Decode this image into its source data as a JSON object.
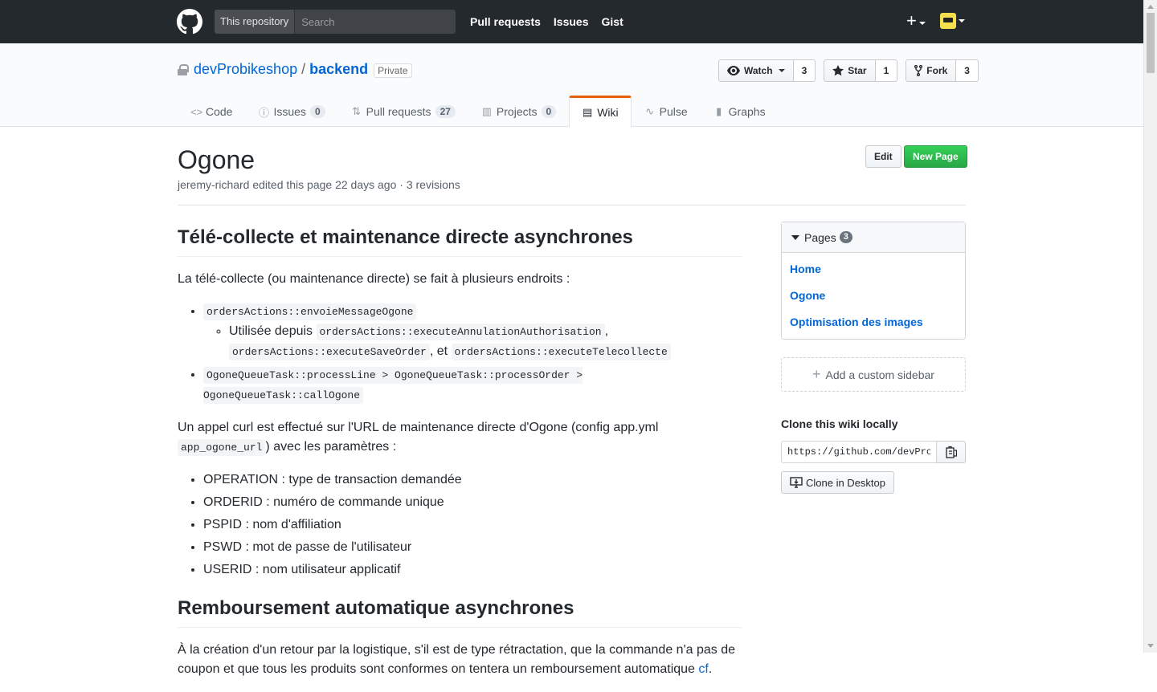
{
  "header": {
    "search_scope": "This repository",
    "search_placeholder": "Search",
    "nav": [
      "Pull requests",
      "Issues",
      "Gist"
    ],
    "add_symbol": "+"
  },
  "repo": {
    "owner": "devProbikeshop",
    "separator": "/",
    "name": "backend",
    "visibility": "Private",
    "watch": {
      "label": "Watch",
      "count": "3"
    },
    "star": {
      "label": "Star",
      "count": "1"
    },
    "fork": {
      "label": "Fork",
      "count": "3"
    }
  },
  "reponav": {
    "code": "Code",
    "issues": {
      "label": "Issues",
      "count": "0"
    },
    "pulls": {
      "label": "Pull requests",
      "count": "27"
    },
    "projects": {
      "label": "Projects",
      "count": "0"
    },
    "wiki": "Wiki",
    "pulse": "Pulse",
    "graphs": "Graphs"
  },
  "wiki": {
    "title": "Ogone",
    "meta": "jeremy-richard edited this page 22 days ago · 3 revisions",
    "edit_label": "Edit",
    "new_page_label": "New Page"
  },
  "content": {
    "h2_1": "Télé-collecte et maintenance directe asynchrones",
    "p1": "La télé-collecte (ou maintenance directe) se fait à plusieurs endroits :",
    "li1_code": "ordersActions::envoieMessageOgone",
    "li1_sub_text": "Utilisée depuis ",
    "li1_sub_code1": "ordersActions::executeAnnulationAuthorisation",
    "li1_sub_sep1": ", ",
    "li1_sub_code2": "ordersActions::executeSaveOrder",
    "li1_sub_sep2": ", et ",
    "li1_sub_code3": "ordersActions::executeTelecollecte",
    "li2_code": "OgoneQueueTask::processLine > OgoneQueueTask::processOrder > OgoneQueueTask::callOgone",
    "p2_a": "Un appel curl est effectué sur l'URL de maintenance directe d'Ogone (config app.yml ",
    "p2_code": "app_ogone_url",
    "p2_b": ") avec les paramètres :",
    "params": [
      "OPERATION : type de transaction demandée",
      "ORDERID : numéro de commande unique",
      "PSPID : nom d'affiliation",
      "PSWD : mot de passe de l'utilisateur",
      "USERID : nom utilisateur applicatif"
    ],
    "h2_2": "Remboursement automatique asynchrones",
    "p3": "À la création d'un retour par la logistique, s'il est de type rétractation, que la commande n'a pas de coupon et que tous les produits sont conformes on tentera un remboursement automatique ",
    "p3_link": "cf",
    "p3_end": "."
  },
  "sidebar": {
    "pages_label": "Pages",
    "pages_count": "3",
    "pages": [
      "Home",
      "Ogone",
      "Optimisation des images"
    ],
    "add_custom": "Add a custom sidebar",
    "clone_title": "Clone this wiki locally",
    "clone_url": "https://github.com/devProbikeshop/backend.wiki.git",
    "clone_desktop": "Clone in Desktop"
  },
  "colors": {
    "header_bg": "#24292e",
    "link": "#0366d6",
    "primary_green": "#28a745",
    "selected_tab_accent": "#e36209"
  },
  "icons": [
    "github-logo-icon",
    "lock-icon",
    "eye-icon",
    "star-icon",
    "fork-icon",
    "code-icon",
    "issue-icon",
    "pull-request-icon",
    "project-icon",
    "book-icon",
    "pulse-icon",
    "graph-icon",
    "clipboard-icon",
    "desktop-download-icon"
  ]
}
